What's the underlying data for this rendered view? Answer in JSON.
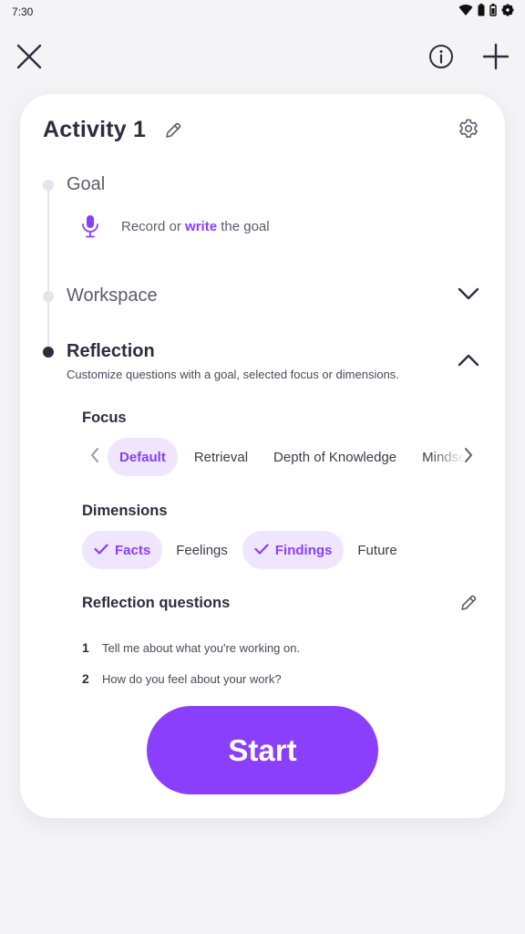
{
  "status_bar": {
    "time": "7:30",
    "icons": [
      "wifi-icon",
      "battery-icon",
      "battery-alt-icon",
      "settings-gear-icon"
    ]
  },
  "topbar": {
    "close_icon": "close-icon",
    "info_icon": "info-icon",
    "add_icon": "plus-icon"
  },
  "activity": {
    "title": "Activity 1",
    "edit_icon": "pencil-icon",
    "settings_icon": "gear-icon"
  },
  "steps": {
    "goal": {
      "label": "Goal",
      "record_text": "Record or",
      "write_link": "write",
      "goal_suffix": "the goal"
    },
    "workspace": {
      "label": "Workspace",
      "expanded": false
    },
    "reflection": {
      "label": "Reflection",
      "description": "Customize questions with a goal, selected focus or dimensions.",
      "expanded": true
    }
  },
  "focus": {
    "title": "Focus",
    "options": [
      {
        "label": "Default",
        "selected": true
      },
      {
        "label": "Retrieval",
        "selected": false
      },
      {
        "label": "Depth of Knowledge",
        "selected": false
      },
      {
        "label": "Mindset",
        "selected": false
      }
    ]
  },
  "dimensions": {
    "title": "Dimensions",
    "options": [
      {
        "label": "Facts",
        "selected": true
      },
      {
        "label": "Feelings",
        "selected": false
      },
      {
        "label": "Findings",
        "selected": true
      },
      {
        "label": "Future",
        "selected": false
      }
    ]
  },
  "questions": {
    "title": "Reflection questions",
    "items": [
      {
        "number": "1",
        "text": "Tell me about what you're working on."
      },
      {
        "number": "2",
        "text": "How do you feel about your work?"
      }
    ]
  },
  "start_button": {
    "label": "Start"
  },
  "colors": {
    "accent": "#8a3ffc",
    "accent_light": "#efe6fd",
    "text_dark": "#2e2d3d",
    "background": "#f4f4f7"
  }
}
